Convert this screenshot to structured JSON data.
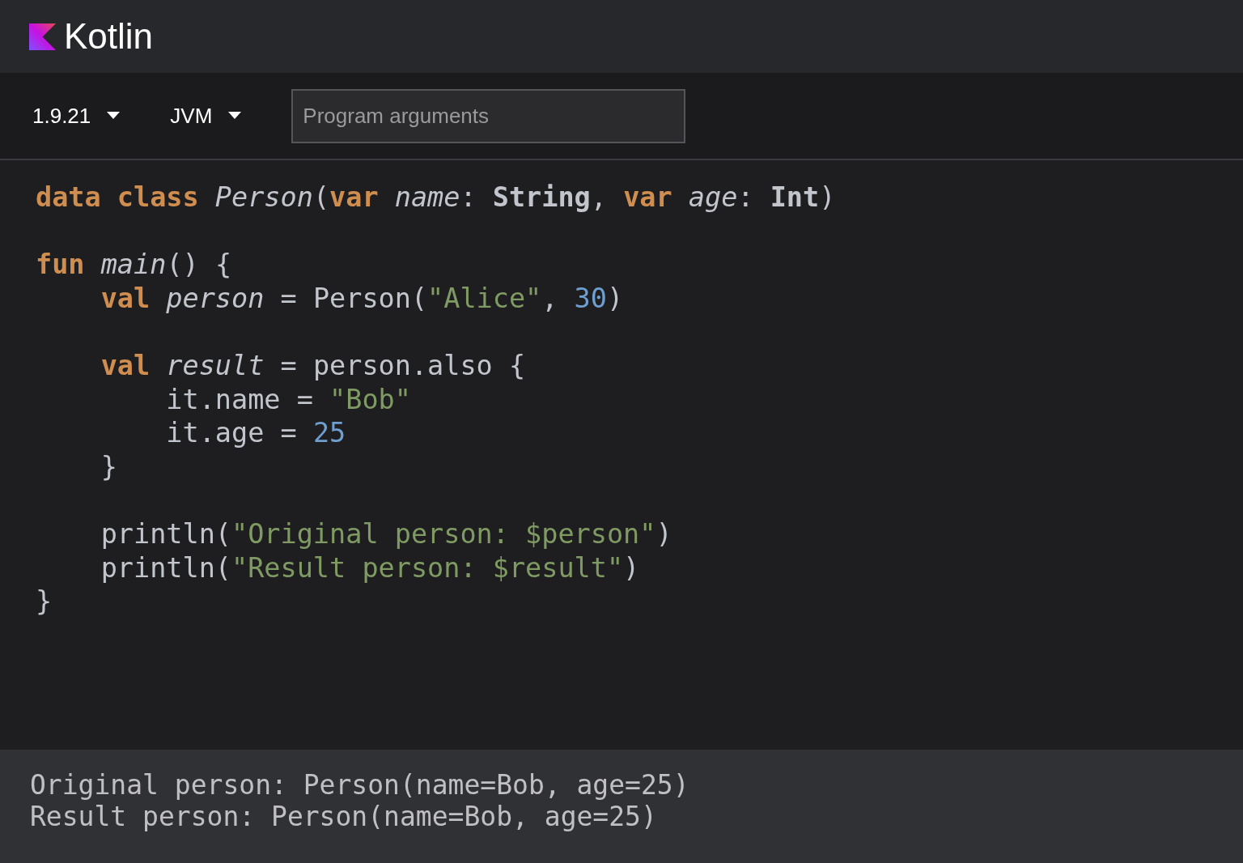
{
  "header": {
    "brand": "Kotlin"
  },
  "toolbar": {
    "version": "1.9.21",
    "platform": "JVM",
    "arguments": {
      "placeholder": "Program arguments"
    }
  },
  "code_blocks": [
    [
      [
        {
          "text": "data ",
          "kind": "keyword"
        },
        {
          "text": "class ",
          "kind": "keyword"
        },
        {
          "text": "Person",
          "kind": "declaration"
        },
        {
          "text": "(",
          "kind": "plain"
        },
        {
          "text": "var ",
          "kind": "keyword"
        },
        {
          "text": "name",
          "kind": "declaration"
        },
        {
          "text": ": ",
          "kind": "plain"
        },
        {
          "text": "String",
          "kind": "type"
        },
        {
          "text": ", ",
          "kind": "plain"
        },
        {
          "text": "var ",
          "kind": "keyword"
        },
        {
          "text": "age",
          "kind": "declaration"
        },
        {
          "text": ": ",
          "kind": "plain"
        },
        {
          "text": "Int",
          "kind": "type"
        },
        {
          "text": ")",
          "kind": "plain"
        }
      ]
    ],
    [
      [
        {
          "text": "fun ",
          "kind": "keyword"
        },
        {
          "text": "main",
          "kind": "declaration"
        },
        {
          "text": "() {",
          "kind": "plain"
        }
      ],
      [
        {
          "text": "    val ",
          "kind": "keyword"
        },
        {
          "text": "person",
          "kind": "declaration"
        },
        {
          "text": " = Person(",
          "kind": "plain"
        },
        {
          "text": "\"Alice\"",
          "kind": "string"
        },
        {
          "text": ", ",
          "kind": "plain"
        },
        {
          "text": "30",
          "kind": "number"
        },
        {
          "text": ")",
          "kind": "plain"
        }
      ]
    ],
    [
      [
        {
          "text": "    val ",
          "kind": "keyword"
        },
        {
          "text": "result",
          "kind": "declaration"
        },
        {
          "text": " = person.also {",
          "kind": "plain"
        }
      ],
      [
        {
          "text": "        it.name = ",
          "kind": "plain"
        },
        {
          "text": "\"Bob\"",
          "kind": "string"
        }
      ],
      [
        {
          "text": "        it.age = ",
          "kind": "plain"
        },
        {
          "text": "25",
          "kind": "number"
        }
      ],
      [
        {
          "text": "    }",
          "kind": "plain"
        }
      ]
    ],
    [
      [
        {
          "text": "    println(",
          "kind": "plain"
        },
        {
          "text": "\"Original person: $person\"",
          "kind": "string"
        },
        {
          "text": ")",
          "kind": "plain"
        }
      ],
      [
        {
          "text": "    println(",
          "kind": "plain"
        },
        {
          "text": "\"Result person: $result\"",
          "kind": "string"
        },
        {
          "text": ")",
          "kind": "plain"
        }
      ],
      [
        {
          "text": "}",
          "kind": "plain"
        }
      ]
    ]
  ],
  "output": [
    "Original person: Person(name=Bob, age=25)",
    "Result person: Person(name=Bob, age=25)"
  ]
}
